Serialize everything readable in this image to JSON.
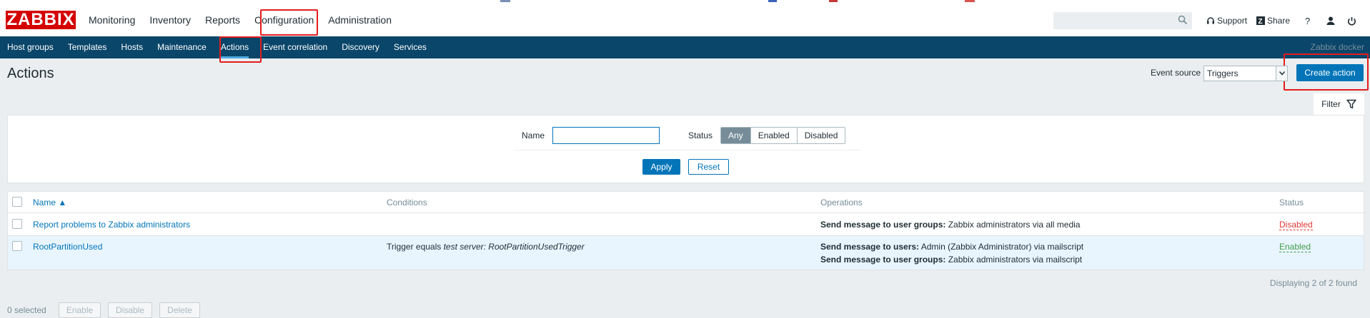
{
  "header": {
    "logo": "ZABBIX",
    "nav": [
      "Monitoring",
      "Inventory",
      "Reports",
      "Configuration",
      "Administration"
    ],
    "support_label": "Support",
    "share_label": "Share",
    "help_label": "?"
  },
  "subnav": {
    "items": [
      "Host groups",
      "Templates",
      "Hosts",
      "Maintenance",
      "Actions",
      "Event correlation",
      "Discovery",
      "Services"
    ],
    "server_name": "Zabbix docker"
  },
  "page": {
    "title": "Actions",
    "event_source_label": "Event source",
    "event_source_value": "Triggers",
    "create_button": "Create action"
  },
  "filter": {
    "tab_label": "Filter",
    "name_label": "Name",
    "name_value": "",
    "status_label": "Status",
    "status_options": [
      "Any",
      "Enabled",
      "Disabled"
    ],
    "status_selected": "Any",
    "apply_label": "Apply",
    "reset_label": "Reset"
  },
  "table": {
    "headers": {
      "name": "Name ▲",
      "conditions": "Conditions",
      "operations": "Operations",
      "status": "Status"
    },
    "rows": [
      {
        "name": "Report problems to Zabbix administrators",
        "condition_prefix": "",
        "condition_italic": "",
        "ops": [
          {
            "bold": "Send message to user groups:",
            "text": " Zabbix administrators via all media"
          }
        ],
        "status": "Disabled"
      },
      {
        "name": "RootPartitionUsed",
        "condition_prefix": "Trigger equals ",
        "condition_italic": "test server: RootPartitionUsedTrigger",
        "ops": [
          {
            "bold": "Send message to users:",
            "text": " Admin (Zabbix Administrator) via mailscript"
          },
          {
            "bold": "Send message to user groups:",
            "text": " Zabbix administrators via mailscript"
          }
        ],
        "status": "Enabled"
      }
    ],
    "footer": "Displaying 2 of 2 found"
  },
  "bottom": {
    "selected": "0 selected",
    "buttons": [
      "Enable",
      "Disable",
      "Delete"
    ]
  },
  "colors": {
    "brand": "#d40000",
    "subnav_bg": "#0a466a",
    "primary": "#0275b8",
    "disabled_status": "#e33734",
    "enabled_status": "#429e47",
    "highlight_box": "#e31d1d"
  }
}
